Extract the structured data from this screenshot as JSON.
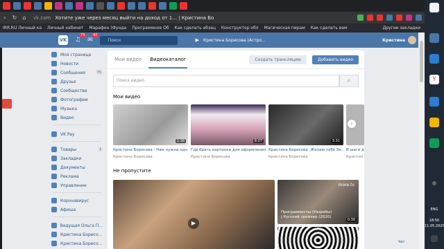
{
  "browser": {
    "url": "vk.com",
    "page_title": "Хотите уже через месяц выйти на доход от 1... | Кристина Борисс...",
    "bookmarks": [
      "IRR.RU Личный ка",
      "Личный кабинет",
      "Марафон (Фунда",
      "Программное Об",
      "Как сделать абзац",
      "Конструктор обл",
      "Магическая пирам",
      "Как сделать вам"
    ],
    "other_bookmarks": "Другие закладки"
  },
  "vk_header": {
    "logo": "VK",
    "badges": [
      "73",
      "47"
    ],
    "search_placeholder": "Поиск",
    "now_playing": "Кристина Борисова |Астро...",
    "user_name": "Кристина"
  },
  "sidebar": {
    "items": [
      {
        "label": "Моя страница",
        "icon": "home-icon"
      },
      {
        "label": "Новости",
        "icon": "news-icon"
      },
      {
        "label": "Сообщения",
        "icon": "message-icon",
        "badge": "75"
      },
      {
        "label": "Друзья",
        "icon": "friends-icon"
      },
      {
        "label": "Сообщества",
        "icon": "groups-icon"
      },
      {
        "label": "Фотографии",
        "icon": "photo-icon"
      },
      {
        "label": "Музыка",
        "icon": "music-icon"
      },
      {
        "label": "Видео",
        "icon": "video-icon"
      },
      {
        "label": "VK Pay",
        "icon": "vkpay-icon"
      },
      {
        "label": "Товары",
        "icon": "goods-icon",
        "badge": "1"
      },
      {
        "label": "Закладки",
        "icon": "bookmark-icon"
      },
      {
        "label": "Документы",
        "icon": "docs-icon"
      },
      {
        "label": "Реклама",
        "icon": "ads-icon"
      },
      {
        "label": "Управление",
        "icon": "manage-icon"
      },
      {
        "label": "Коронавирус",
        "icon": "virus-icon"
      },
      {
        "label": "Афиша",
        "icon": "afisha-icon"
      },
      {
        "label": "Ведущая Ольга П...",
        "icon": "group-avatar-icon"
      },
      {
        "label": "Кристина Борисо...",
        "icon": "group-avatar-icon"
      },
      {
        "label": "Кристина Борисо...",
        "icon": "group-avatar-icon"
      }
    ]
  },
  "video_page": {
    "tab_my": "Мои видео",
    "tab_catalog": "Видеокаталог",
    "btn_live": "Создать трансляцию",
    "btn_add": "Добавить видео",
    "search_placeholder": "Поиск видео",
    "section_my": "Мои видео",
    "section_dont_miss": "Не пропустите",
    "my_videos": [
      {
        "title": "Кристина Борисова - Нам нужна одн...",
        "author": "Кристина Борисова",
        "duration": "2:38"
      },
      {
        "title": "Где брать картинки для оформления...",
        "author": "Кристина Борисова",
        "duration": "8:07",
        "badge": "YouTube"
      },
      {
        "title": "Кристина Борисова ,Желаю тебе Зе...",
        "author": "Кристина Борисова",
        "duration": "3:31"
      },
      {
        "title": "В шаге д",
        "author": "Кристин",
        "duration": ""
      }
    ],
    "featured": [
      {
        "title": "Программисты (Разрабы) | Русский трейлер (2020)",
        "duration": "0:38",
        "channel_mark": "more.tv"
      }
    ]
  },
  "chat_label": "Чат",
  "taskbar": {
    "lang": "ENG",
    "time": "18:50",
    "date": "11.05.2020"
  }
}
